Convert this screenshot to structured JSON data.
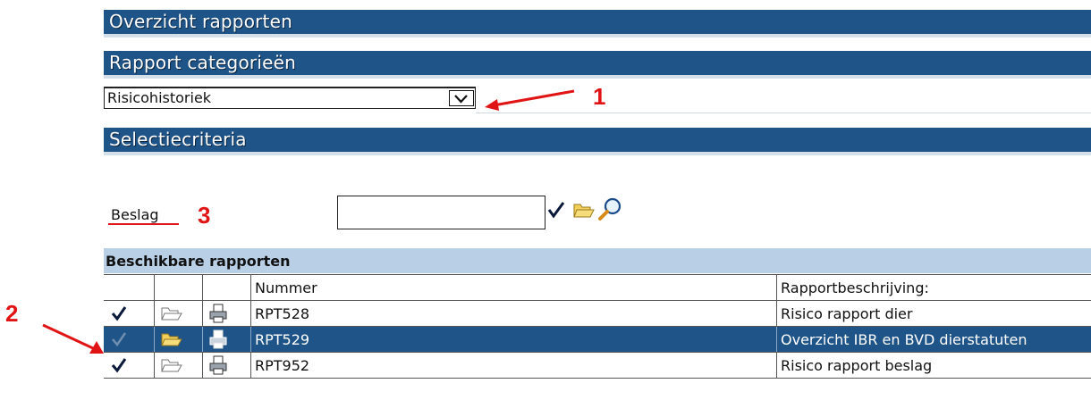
{
  "headers": {
    "overview": "Overzicht rapporten",
    "categories": "Rapport categorieën",
    "selection": "Selectiecriteria"
  },
  "category_select": {
    "value": "Risicohistoriek"
  },
  "annotations": {
    "n1": "1",
    "n2": "2",
    "n3": "3"
  },
  "colors": {
    "header_bg": "#1f5488",
    "subheader_bg": "#b8cfe6",
    "annotation": "#e01414"
  },
  "beslag": {
    "label": "Beslag",
    "value": ""
  },
  "reports": {
    "title": "Beschikbare rapporten",
    "columns": {
      "number": "Nummer",
      "description": "Rapportbeschrijving:"
    },
    "rows": [
      {
        "number": "RPT528",
        "description": "Risico rapport dier",
        "selected": false
      },
      {
        "number": "RPT529",
        "description": "Overzicht IBR en BVD dierstatuten",
        "selected": true
      },
      {
        "number": "RPT952",
        "description": "Risico rapport beslag",
        "selected": false
      }
    ]
  }
}
